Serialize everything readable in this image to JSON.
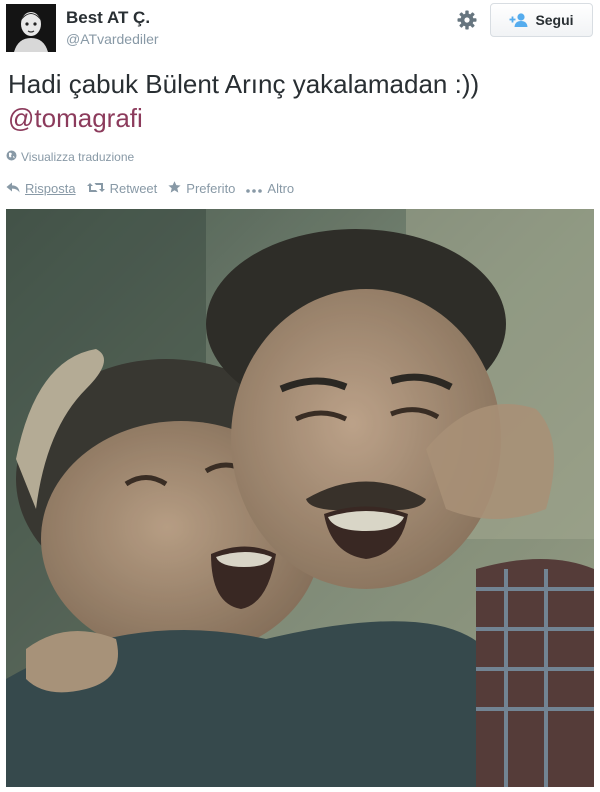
{
  "user": {
    "display_name": "Best AT Ç.",
    "handle": "@ATvardediler"
  },
  "header": {
    "settings_icon": "gear-icon",
    "follow_label": "Segui",
    "follow_icon": "add-user-icon"
  },
  "tweet": {
    "text": "Hadi çabuk Bülent Arınç yakalamadan :))",
    "mention": "@tomagrafi",
    "translate_label": "Visualizza traduzione"
  },
  "actions": {
    "reply": "Risposta",
    "retweet": "Retweet",
    "favorite": "Preferito",
    "more": "Altro"
  },
  "colors": {
    "mention": "#8c3b5c",
    "muted": "#8899a6",
    "text": "#292f33"
  }
}
